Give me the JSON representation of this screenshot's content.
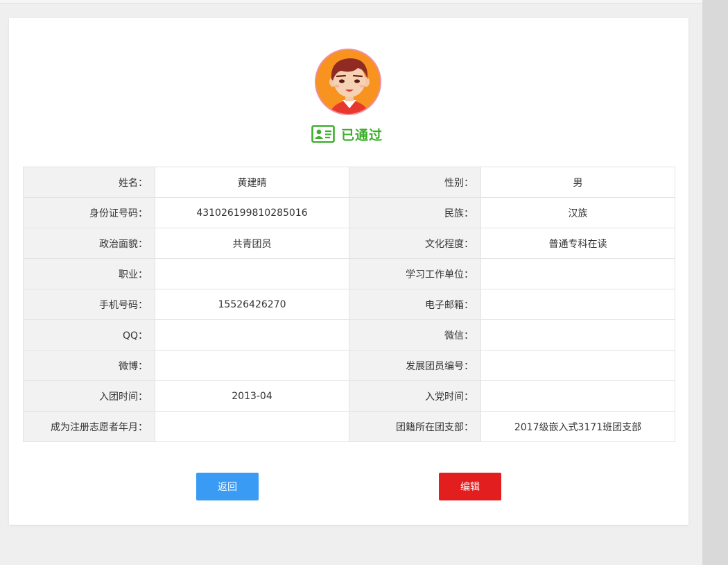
{
  "status": {
    "label": "已通过",
    "color": "#3cae2c",
    "icon": "id-card-icon"
  },
  "avatar": {
    "icon": "user-avatar"
  },
  "rows": [
    {
      "l1": "姓名：",
      "v1": "黄建晴",
      "l2": "性别：",
      "v2": "男"
    },
    {
      "l1": "身份证号码：",
      "v1": "431026199810285016",
      "l2": "民族：",
      "v2": "汉族"
    },
    {
      "l1": "政治面貌：",
      "v1": "共青团员",
      "l2": "文化程度：",
      "v2": "普通专科在读"
    },
    {
      "l1": "职业：",
      "v1": "",
      "l2": "学习工作单位：",
      "v2": ""
    },
    {
      "l1": "手机号码：",
      "v1": "15526426270",
      "l2": "电子邮箱：",
      "v2": ""
    },
    {
      "l1": "QQ：",
      "v1": "",
      "l2": "微信：",
      "v2": ""
    },
    {
      "l1": "微博：",
      "v1": "",
      "l2": "发展团员编号：",
      "v2": ""
    },
    {
      "l1": "入团时间：",
      "v1": "2013-04",
      "l2": "入党时间：",
      "v2": ""
    },
    {
      "l1": "成为注册志愿者年月：",
      "v1": "",
      "l2": "团籍所在团支部：",
      "v2": "2017级嵌入式3171班团支部"
    }
  ],
  "buttons": {
    "back": "返回",
    "edit": "编辑"
  },
  "colors": {
    "back_button": "#3a9bf5",
    "edit_button": "#e31e1e"
  }
}
